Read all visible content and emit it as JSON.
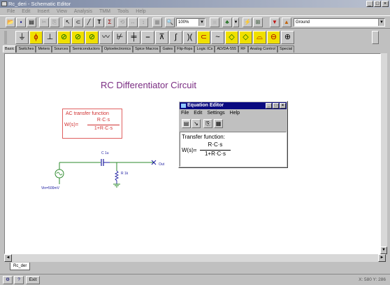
{
  "window": {
    "title": "Rc_deri - Schematic Editor",
    "minimize": "_",
    "maximize": "□",
    "close": "×"
  },
  "menu": [
    "File",
    "Edit",
    "Insert",
    "View",
    "Analysis",
    "TMM",
    "Tools",
    "Help"
  ],
  "toolbar": {
    "zoom": "100%",
    "ground": "Ground"
  },
  "component_tabs": [
    "Basic",
    "Switches",
    "Meters",
    "Sources",
    "Semiconductors",
    "Optoelectronics",
    "Spice Macros",
    "Gates",
    "Flip-flops",
    "Logic ICs",
    "AD/DA-555",
    "RF",
    "Analog Control",
    "Special"
  ],
  "schematic": {
    "title": "RC Differentiator Circuit",
    "tf_label": "AC transfer function",
    "tf_lhs": "W(s)=",
    "tf_num": "R·C·s",
    "tf_den": "1+R·C·s",
    "cap_label": "C 1u",
    "res_label": "R 1k",
    "out_label": "Out",
    "src_label": "Vin=500mV"
  },
  "equation_editor": {
    "title": "Equation Editor",
    "menu": [
      "File",
      "Edit",
      "Settings",
      "Help"
    ],
    "text_label": "Transfer function:",
    "lhs": "W(s)=",
    "num": "R·C·s",
    "den": "1+R·C·s"
  },
  "document_tab": "Rc_der",
  "status": {
    "exit": "Exit",
    "coords": "X: 580  Y: 286"
  },
  "colors": {
    "title_color": "#7a2c82",
    "tf_color": "#d03030",
    "wire_color": "#2e8b2e",
    "component_color": "#1a1aa0",
    "eq_title_bg": "#0a0a80"
  }
}
